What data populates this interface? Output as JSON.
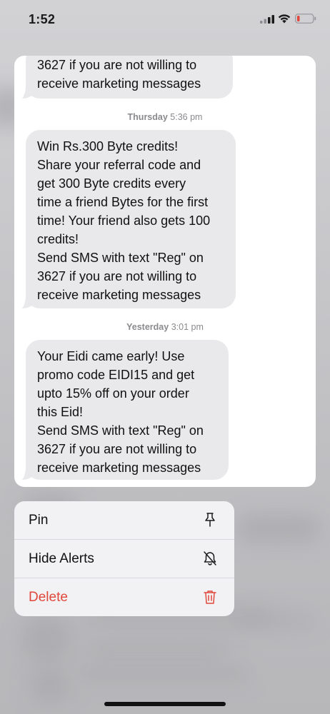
{
  "status_bar": {
    "time": "1:52"
  },
  "messages": {
    "bubble_1": {
      "lines": [
        "3627 if you are not willing to",
        "receive marketing messages"
      ]
    },
    "timestamp_2": {
      "day": "Thursday",
      "time": "5:36 pm"
    },
    "bubble_2": {
      "lines": [
        "Win Rs.300 Byte credits!",
        "Share your referral code and",
        "get 300 Byte credits every",
        "time a friend Bytes for the first",
        "time! Your friend also gets 100",
        "credits!",
        "Send SMS with text \"Reg\" on",
        "3627 if you are not willing to",
        "receive marketing messages"
      ]
    },
    "timestamp_3": {
      "day": "Yesterday",
      "time": "3:01 pm"
    },
    "bubble_3": {
      "lines": [
        "Your Eidi came early! Use",
        "promo code EIDI15 and get",
        "upto 15% off on your order",
        "this Eid!",
        "Send SMS with text \"Reg\" on",
        "3627 if you are not willing to",
        "receive marketing messages"
      ]
    }
  },
  "menu": {
    "pin": {
      "label": "Pin",
      "icon": "pin-icon"
    },
    "hide_alerts": {
      "label": "Hide Alerts",
      "icon": "bell-slash-icon"
    },
    "delete": {
      "label": "Delete",
      "icon": "trash-icon",
      "color": "#e0473a"
    }
  }
}
